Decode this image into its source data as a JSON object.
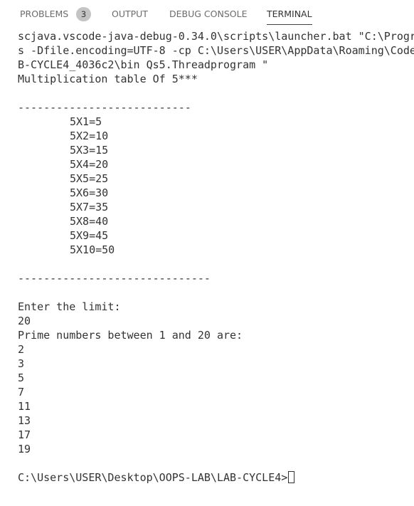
{
  "panel": {
    "tabs": [
      {
        "label": "PROBLEMS",
        "badge": "3"
      },
      {
        "label": "OUTPUT"
      },
      {
        "label": "DEBUG CONSOLE"
      },
      {
        "label": "TERMINAL",
        "active": true
      }
    ]
  },
  "terminal": {
    "launch_lines": [
      "scjava.vscode-java-debug-0.34.0\\scripts\\launcher.bat \"C:\\Progr",
      "s -Dfile.encoding=UTF-8 -cp C:\\Users\\USER\\AppData\\Roaming\\Code",
      "B-CYCLE4_4036c2\\bin Qs5.Threadprogram \""
    ],
    "table_title": "Multiplication table Of 5***",
    "separator_1": "---------------------------",
    "table_rows": [
      "5X1=5",
      "5X2=10",
      "5X3=15",
      "5X4=20",
      "5X5=25",
      "5X6=30",
      "5X7=35",
      "5X8=40",
      "5X9=45",
      "5X10=50"
    ],
    "separator_2": "------------------------------",
    "limit_prompt": "Enter the limit:",
    "limit_input": "20",
    "primes_header": "Prime numbers between 1 and 20 are:",
    "primes": [
      "2",
      "3",
      "5",
      "7",
      "11",
      "13",
      "17",
      "19"
    ],
    "prompt": "C:\\Users\\USER\\Desktop\\OOPS-LAB\\LAB-CYCLE4>"
  }
}
